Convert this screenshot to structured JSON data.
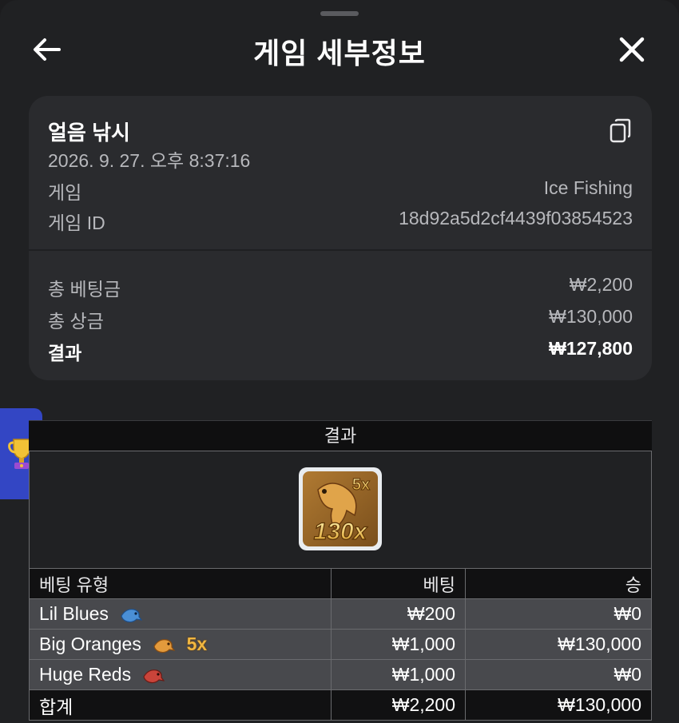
{
  "header": {
    "title": "게임 세부정보",
    "back_icon": "arrow-left-icon",
    "close_icon": "close-icon"
  },
  "summary": {
    "game_name": "얼음 낚시",
    "datetime": "2026. 9. 27. 오후 8:37:16",
    "game_label": "게임",
    "game_value": "Ice Fishing",
    "id_label": "게임 ID",
    "id_value": "18d92a5d2cf4439f03854523",
    "total_bet_label": "총 베팅금",
    "total_bet_value": "₩2,200",
    "total_prize_label": "총 상금",
    "total_prize_value": "₩130,000",
    "result_label": "결과",
    "result_value": "₩127,800"
  },
  "results": {
    "title": "결과",
    "tile": {
      "multiplier_small": "5x",
      "multiplier_big": "130x"
    },
    "columns": [
      "베팅 유형",
      "베팅",
      "승"
    ],
    "rows": [
      {
        "type": "Lil Blues",
        "bet": "₩200",
        "win": "₩0",
        "fish_color": "#4a8fd6",
        "mult": ""
      },
      {
        "type": "Big Oranges",
        "bet": "₩1,000",
        "win": "₩130,000",
        "fish_color": "#e39a3c",
        "mult": "5x"
      },
      {
        "type": "Huge Reds",
        "bet": "₩1,000",
        "win": "₩0",
        "fish_color": "#c9443a",
        "mult": ""
      }
    ],
    "total": {
      "label": "합계",
      "bet": "₩2,200",
      "win": "₩130,000"
    }
  },
  "colors": {
    "accent_tab": "#3346c4",
    "multiplier": "#f0b640"
  }
}
